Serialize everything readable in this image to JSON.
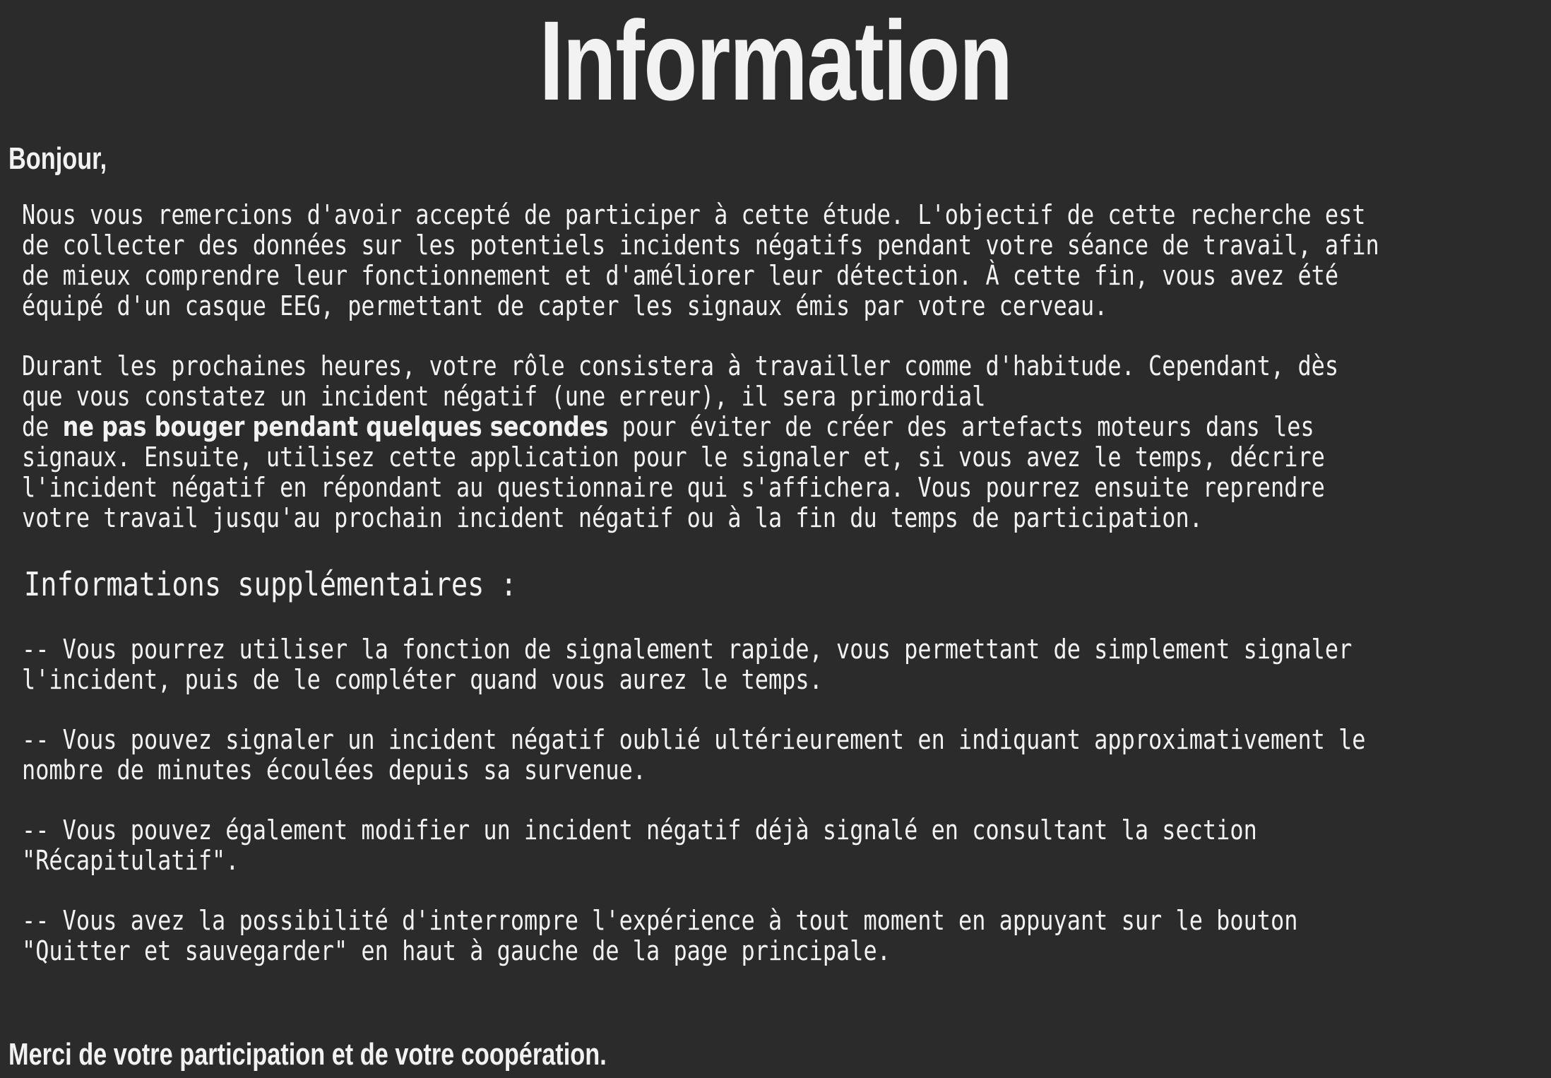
{
  "page": {
    "title": "Information",
    "greeting": "Bonjour,",
    "paragraph1": "Nous vous remercions d'avoir accepté de participer à cette étude. L'objectif de cette recherche est\nde collecter des données sur les potentiels incidents négatifs pendant votre séance de travail, afin\nde mieux comprendre leur fonctionnement et d'améliorer leur détection. À cette fin, vous avez été\néquipé d'un casque EEG, permettant de capter les signaux émis par votre cerveau.",
    "paragraph2_intro": "Durant les prochaines heures, votre rôle consistera à travailler comme d'habitude. Cependant, dès\nque vous constatez un incident négatif (une erreur), il sera primordial\nde ",
    "paragraph2_emphasis": "ne pas bouger pendant quelques secondes",
    "paragraph2_rest": " pour éviter de créer des artefacts moteurs dans les\nsignaux. Ensuite, utilisez cette application pour le signaler et, si vous avez le temps, décrire\nl'incident négatif en répondant au questionnaire qui s'affichera. Vous pourrez ensuite reprendre\nvotre travail jusqu'au prochain incident négatif ou à la fin du temps de participation.",
    "section_heading": "Informations supplémentaires :",
    "bullets": [
      "-- Vous pourrez utiliser la fonction de signalement rapide, vous permettant de simplement signaler\nl'incident, puis de le compléter quand vous aurez le temps.",
      "-- Vous pouvez signaler un incident négatif oublié ultérieurement en indiquant approximativement le\nnombre de minutes écoulées depuis sa survenue.",
      "-- Vous pouvez également modifier un incident négatif déjà signalé en consultant la section\n\"Récapitulatif\".",
      "-- Vous avez la possibilité d'interrompre l'expérience à tout moment en appuyant sur le bouton\n\"Quitter et sauvegarder\" en haut à gauche de la page principale."
    ],
    "footer": "Merci de votre participation et de votre coopération."
  }
}
